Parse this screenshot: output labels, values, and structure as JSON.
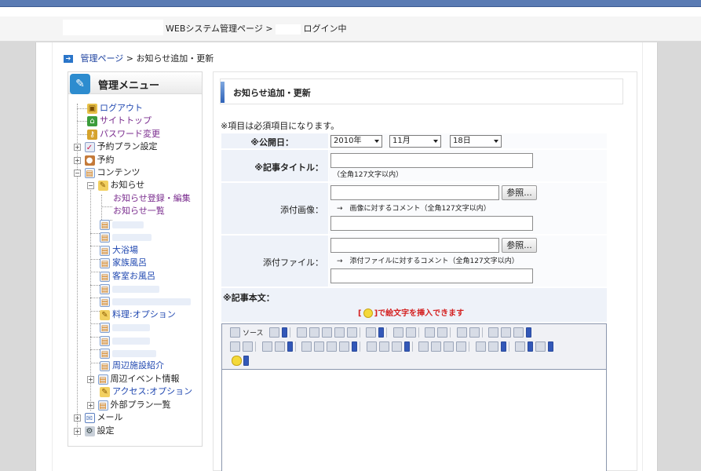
{
  "header": {
    "title": "WEBシステム管理ページ >",
    "login_status": "ログイン中"
  },
  "breadcrumb": {
    "home_link": "管理ページ",
    "separator": ">",
    "current": "お知らせ追加・更新"
  },
  "sidebar": {
    "title": "管理メニュー",
    "items": [
      {
        "label": "ログアウト",
        "icon": "lock-icon"
      },
      {
        "label": "サイトトップ",
        "icon": "home-icon"
      },
      {
        "label": "パスワード変更",
        "icon": "key-icon"
      },
      {
        "label": "予約プラン設定",
        "icon": "plan-icon"
      },
      {
        "label": "予約",
        "icon": "user-icon"
      },
      {
        "label": "コンテンツ",
        "icon": "folder-icon"
      },
      {
        "label": "お知らせ",
        "icon": "pencil-icon"
      },
      {
        "label": "お知らせ登録・編集",
        "icon": ""
      },
      {
        "label": "お知らせ一覧",
        "icon": ""
      },
      {
        "label": "大浴場",
        "icon": "doc-icon"
      },
      {
        "label": "家族風呂",
        "icon": "doc-icon"
      },
      {
        "label": "客室お風呂",
        "icon": "doc-icon"
      },
      {
        "label": "料理:オプション",
        "icon": "pencil-icon"
      },
      {
        "label": "周辺施設紹介",
        "icon": "doc-icon"
      },
      {
        "label": "周辺イベント情報",
        "icon": "doc-icon"
      },
      {
        "label": "アクセス:オプション",
        "icon": "pencil-icon"
      },
      {
        "label": "外部プラン一覧",
        "icon": "doc-icon"
      },
      {
        "label": "メール",
        "icon": "mail-icon"
      },
      {
        "label": "設定",
        "icon": "wrench-icon"
      }
    ]
  },
  "main": {
    "title": "お知らせ追加・更新",
    "required_note": "※項目は必須項目になります。",
    "publish_date": {
      "label": "※公開日：",
      "year": "2010年",
      "month": "11月",
      "day": "18日"
    },
    "article_title": {
      "label": "※記事タイトル：",
      "value": "",
      "hint": "（全角127文字以内）"
    },
    "attach_image": {
      "label": "添付画像：",
      "browse": "参照...",
      "comment_hint": "→　画像に対するコメント（全角127文字以内）"
    },
    "attach_file": {
      "label": "添付ファイル：",
      "browse": "参照...",
      "comment_hint": "→　添付ファイルに対するコメント（全角127文字以内）"
    },
    "article_body": {
      "label": "※記事本文：",
      "emoji_prefix": "[",
      "emoji_suffix": "]で絵文字を挿入できます",
      "source_button": "ソース"
    }
  }
}
